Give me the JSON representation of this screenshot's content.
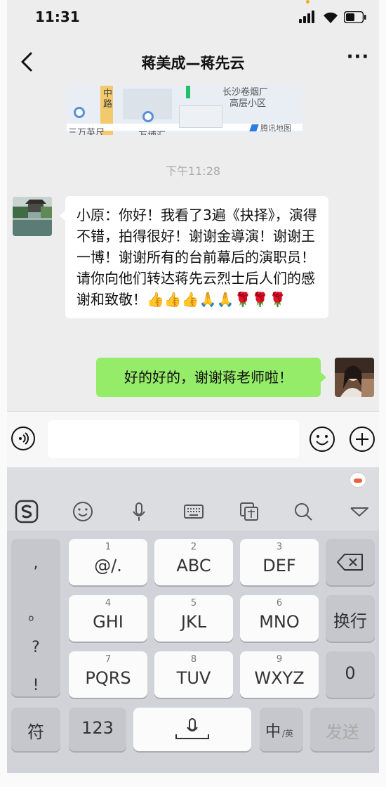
{
  "status_bar": {
    "time": "11:31"
  },
  "header": {
    "title": "蒋美成—蒋先云",
    "more": "···"
  },
  "map_card": {
    "labels": [
      "长沙卷烟厂",
      "高层小区",
      "三万英尺",
      "万博汇"
    ],
    "road_label": "中路",
    "provider": "腾讯地图"
  },
  "chat": {
    "timestamp": "下午11:28",
    "messages": [
      {
        "side": "left",
        "text": "小原：你好！我看了3遍《抉择》，演得不错，拍得很好！谢谢金導演！谢谢王一博！谢谢所有的台前幕后的演职员！请你向他们转达蒋先云烈士后人们的感谢和致敬！👍👍👍🙏🙏🌹🌹🌹"
      },
      {
        "side": "right",
        "text": "好的好的，谢谢蒋老师啦！"
      }
    ]
  },
  "keyboard": {
    "punct": [
      ",",
      "。",
      "?",
      "!"
    ],
    "row1": [
      {
        "num": "1",
        "label": "@/."
      },
      {
        "num": "2",
        "label": "ABC"
      },
      {
        "num": "3",
        "label": "DEF"
      }
    ],
    "row2": [
      {
        "num": "4",
        "label": "GHI"
      },
      {
        "num": "5",
        "label": "JKL"
      },
      {
        "num": "6",
        "label": "MNO"
      }
    ],
    "row3": [
      {
        "num": "7",
        "label": "PQRS"
      },
      {
        "num": "8",
        "label": "TUV"
      },
      {
        "num": "9",
        "label": "WXYZ"
      }
    ],
    "newline": "换行",
    "zero": "0",
    "symbols": "符",
    "numbers": "123",
    "lang": "中",
    "lang_sub": "/英",
    "send": "发送"
  },
  "colors": {
    "sent_bubble": "#95ec69",
    "received_bubble": "#ffffff",
    "chat_bg": "#ededed"
  }
}
